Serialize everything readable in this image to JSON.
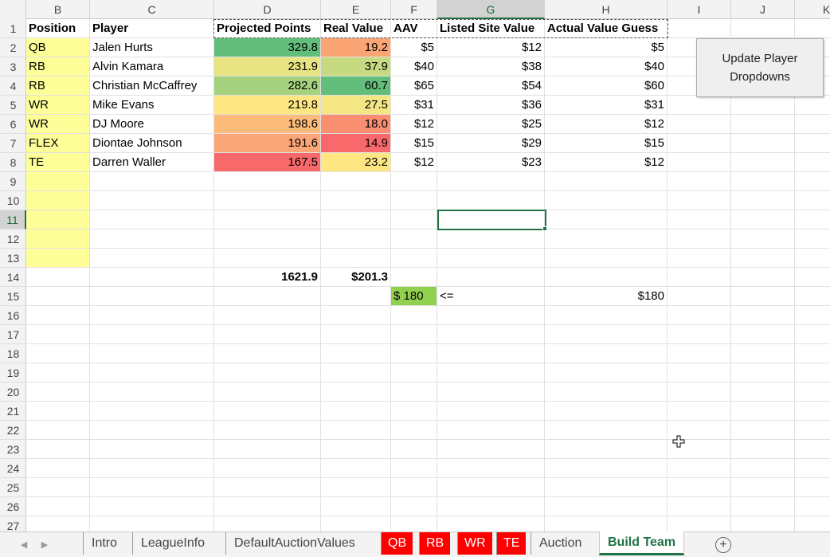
{
  "columns": [
    "B",
    "C",
    "D",
    "E",
    "F",
    "G",
    "H",
    "I",
    "J",
    "K"
  ],
  "rows": [
    "1",
    "2",
    "3",
    "4",
    "5",
    "6",
    "7",
    "8",
    "9",
    "10",
    "11",
    "12",
    "13",
    "14",
    "15",
    "16",
    "17",
    "18",
    "19",
    "20",
    "21",
    "22",
    "23",
    "24",
    "25",
    "26",
    "27"
  ],
  "headers": [
    "Position",
    "Player",
    "Projected Points",
    "Real Value",
    "AAV",
    "Listed Site Value",
    "Actual Value Guess"
  ],
  "roster": [
    {
      "position": "QB",
      "player": "Jalen Hurts",
      "proj": "329.8",
      "real": "19.2",
      "aav": "$5",
      "listed": "$12",
      "guess": "$5",
      "proj_color": "#63be7b",
      "real_color": "#fba575"
    },
    {
      "position": "RB",
      "player": "Alvin Kamara",
      "proj": "231.9",
      "real": "37.9",
      "aav": "$40",
      "listed": "$38",
      "guess": "$40",
      "proj_color": "#e8e483",
      "real_color": "#c6db81"
    },
    {
      "position": "RB",
      "player": "Christian McCaffrey",
      "proj": "282.6",
      "real": "60.7",
      "aav": "$65",
      "listed": "$54",
      "guess": "$60",
      "proj_color": "#a6d27f",
      "real_color": "#63be7b"
    },
    {
      "position": "WR",
      "player": "Mike Evans",
      "proj": "219.8",
      "real": "27.5",
      "aav": "$31",
      "listed": "$36",
      "guess": "$31",
      "proj_color": "#fee783",
      "real_color": "#f3e683"
    },
    {
      "position": "WR",
      "player": "DJ Moore",
      "proj": "198.6",
      "real": "18.0",
      "aav": "$12",
      "listed": "$25",
      "guess": "$12",
      "proj_color": "#fcbb7a",
      "real_color": "#f98e71"
    },
    {
      "position": "FLEX",
      "player": "Diontae Johnson",
      "proj": "191.6",
      "real": "14.9",
      "aav": "$15",
      "listed": "$29",
      "guess": "$15",
      "proj_color": "#fba677",
      "real_color": "#f8696b"
    },
    {
      "position": "TE",
      "player": "Darren Waller",
      "proj": "167.5",
      "real": "23.2",
      "aav": "$12",
      "listed": "$23",
      "guess": "$12",
      "proj_color": "#f8696b",
      "real_color": "#fee783"
    }
  ],
  "totals": {
    "proj": "1621.9",
    "real": "$201.3"
  },
  "budget": {
    "aav": "$ 180",
    "operator": "<=",
    "guess": "$180"
  },
  "button_label": "Update Player Dropdowns",
  "tabs": [
    "Intro",
    "LeagueInfo",
    "DefaultAuctionValues",
    "QB",
    "RB",
    "WR",
    "TE",
    "Auction",
    "Build Team"
  ],
  "active_tab": "Build Team",
  "colors": {
    "position_fill": "#ffff99",
    "budget_fill": "#92d050",
    "accent": "#217346",
    "red_tab": "#ff0000"
  }
}
